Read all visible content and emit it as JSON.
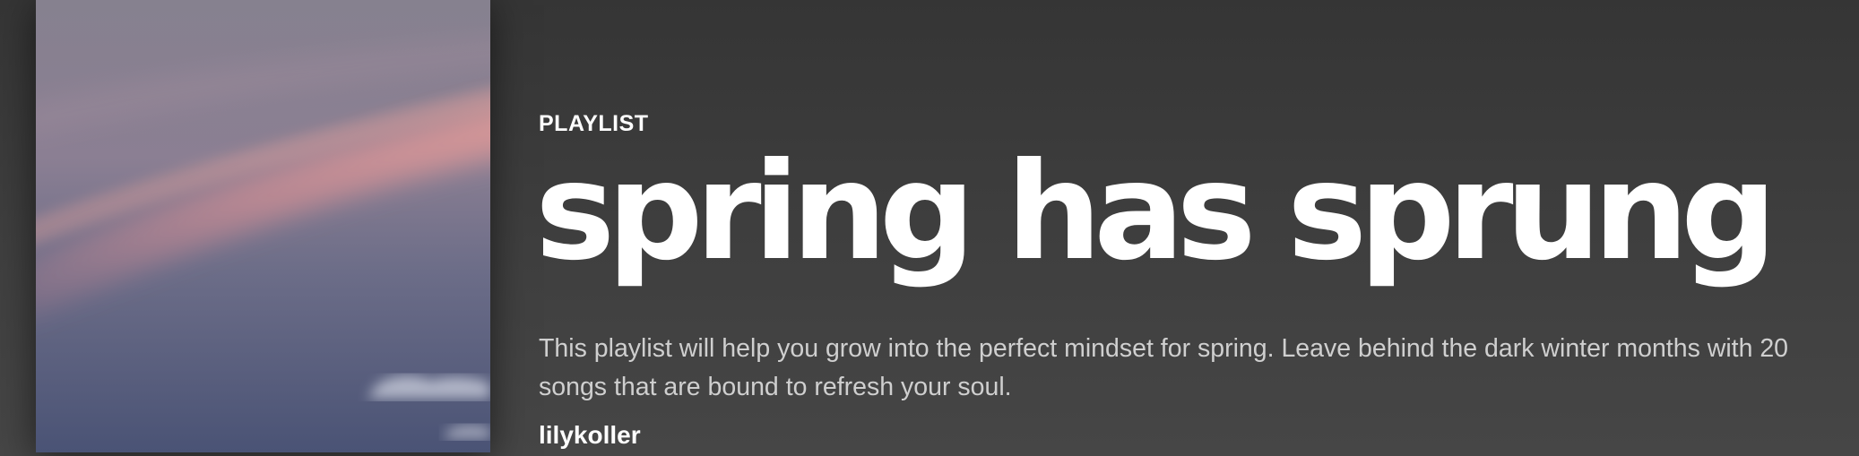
{
  "playlist": {
    "type_label": "PLAYLIST",
    "title": "spring has sprung",
    "description": "This playlist will help you grow into the perfect mindset for spring. Leave behind the dark winter months with 20 songs that are bound to refresh your soul.",
    "owner": "lilykoller"
  },
  "colors": {
    "background": "#3a3a3a",
    "text_primary": "#ffffff",
    "text_secondary": "#cfcfcf"
  }
}
